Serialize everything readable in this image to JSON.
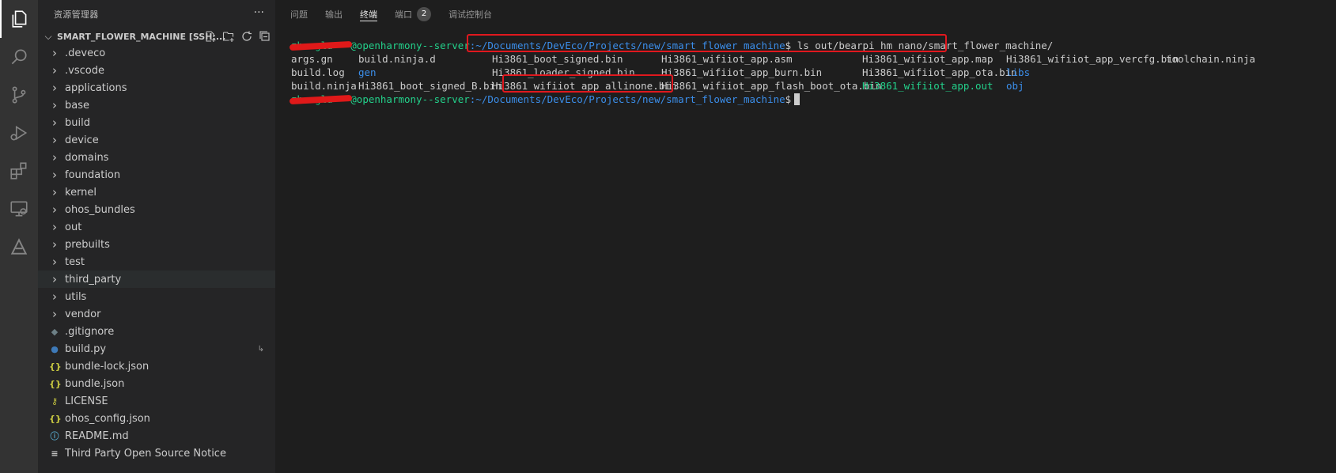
{
  "sidebar": {
    "title": "资源管理器",
    "more": "···",
    "workspace": "SMART_FLOWER_MACHINE [SSH:...",
    "items": [
      {
        "type": "folder",
        "label": ".deveco"
      },
      {
        "type": "folder",
        "label": ".vscode"
      },
      {
        "type": "folder",
        "label": "applications"
      },
      {
        "type": "folder",
        "label": "base"
      },
      {
        "type": "folder",
        "label": "build"
      },
      {
        "type": "folder",
        "label": "device"
      },
      {
        "type": "folder",
        "label": "domains"
      },
      {
        "type": "folder",
        "label": "foundation"
      },
      {
        "type": "folder",
        "label": "kernel"
      },
      {
        "type": "folder",
        "label": "ohos_bundles"
      },
      {
        "type": "folder",
        "label": "out"
      },
      {
        "type": "folder",
        "label": "prebuilts"
      },
      {
        "type": "folder",
        "label": "test"
      },
      {
        "type": "folder",
        "label": "third_party"
      },
      {
        "type": "folder",
        "label": "utils"
      },
      {
        "type": "folder",
        "label": "vendor"
      },
      {
        "type": "file",
        "label": ".gitignore",
        "icon": "gitignore-icon"
      },
      {
        "type": "file",
        "label": "build.py",
        "icon": "python-icon"
      },
      {
        "type": "file",
        "label": "bundle-lock.json",
        "icon": "json-icon"
      },
      {
        "type": "file",
        "label": "bundle.json",
        "icon": "json-icon"
      },
      {
        "type": "file",
        "label": "LICENSE",
        "icon": "license-icon"
      },
      {
        "type": "file",
        "label": "ohos_config.json",
        "icon": "json-icon"
      },
      {
        "type": "file",
        "label": "README.md",
        "icon": "info-icon"
      },
      {
        "type": "file",
        "label": "Third Party Open Source Notice",
        "icon": "text-icon"
      }
    ]
  },
  "panel": {
    "tabs": [
      "问题",
      "输出",
      "终端",
      "端口",
      "调试控制台"
    ],
    "active_tab": "终端",
    "ports_count": "2"
  },
  "terminal": {
    "user": "zhanglu***",
    "host_suffix": "@openharmony--server",
    "path": ":~/Documents/DevEco/Projects/new/smart_flower_machine",
    "command": "$ ls out/bearpi_hm_nano/smart_flower_machine/",
    "prompt_end": "$",
    "files": [
      [
        "args.gn",
        "build.ninja.d",
        "Hi3861_boot_signed.bin",
        "Hi3861_wifiiot_app.asm",
        "Hi3861_wifiiot_app.map",
        "Hi3861_wifiiot_app_vercfg.bin",
        "toolchain.ninja"
      ],
      [
        "build.log",
        "gen",
        "Hi3861_loader_signed.bin",
        "Hi3861_wifiiot_app_burn.bin",
        "Hi3861_wifiiot_app_ota.bin",
        "libs",
        ""
      ],
      [
        "build.ninja",
        "Hi3861_boot_signed_B.bin",
        "Hi3861_wifiiot_app_allinone.bin",
        "Hi3861_wifiiot_app_flash_boot_ota.bin",
        "Hi3861_wifiiot_app.out",
        "obj",
        ""
      ]
    ]
  },
  "colors": {
    "prompt_green": "#23d18b",
    "path_blue": "#3b8eea",
    "highlight_red": "#e0181e"
  }
}
